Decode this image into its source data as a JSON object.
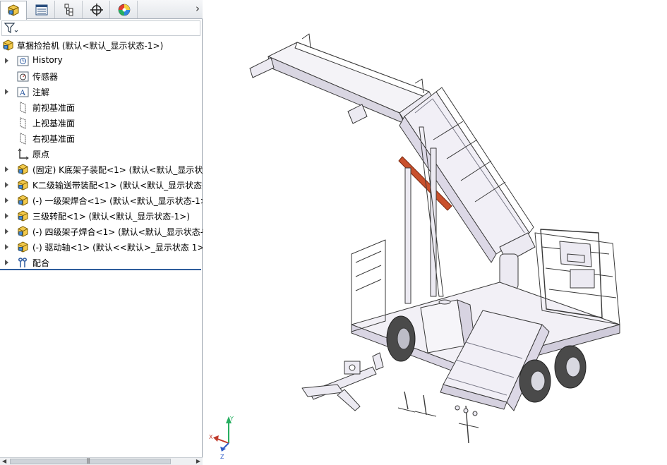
{
  "tabs": [
    {
      "name": "feature-manager",
      "icon": "assembly-icon",
      "active": true
    },
    {
      "name": "property-manager",
      "icon": "property-list-icon",
      "active": false
    },
    {
      "name": "configuration-manager",
      "icon": "configuration-icon",
      "active": false
    },
    {
      "name": "dimxpert-manager",
      "icon": "crosshair-icon",
      "active": false
    },
    {
      "name": "display-manager",
      "icon": "color-wheel-icon",
      "active": false
    }
  ],
  "tree": {
    "root": {
      "label": "草捆捡拾机 (默认<默认_显示状态-1>)",
      "icon": "assembly-icon"
    },
    "items": [
      {
        "label": "History",
        "icon": "history-icon",
        "expandable": true
      },
      {
        "label": "传感器",
        "icon": "sensor-icon",
        "expandable": false
      },
      {
        "label": "注解",
        "icon": "annotation-icon",
        "expandable": true
      },
      {
        "label": "前视基准面",
        "icon": "plane-icon",
        "expandable": false
      },
      {
        "label": "上视基准面",
        "icon": "plane-icon",
        "expandable": false
      },
      {
        "label": "右视基准面",
        "icon": "plane-icon",
        "expandable": false
      },
      {
        "label": "原点",
        "icon": "origin-icon",
        "expandable": false
      },
      {
        "label": "(固定) K底架子装配<1> (默认<默认_显示状态",
        "icon": "subassembly-icon",
        "expandable": true
      },
      {
        "label": "K二级输送带装配<1> (默认<默认_显示状态-",
        "icon": "subassembly-icon",
        "expandable": true
      },
      {
        "label": "(-) 一级架焊合<1> (默认<默认_显示状态-1>",
        "icon": "subassembly-icon",
        "expandable": true
      },
      {
        "label": "三级转配<1> (默认<默认_显示状态-1>)",
        "icon": "subassembly-icon",
        "expandable": true
      },
      {
        "label": "(-) 四级架子焊合<1> (默认<默认_显示状态-",
        "icon": "subassembly-icon",
        "expandable": true
      },
      {
        "label": "(-) 驱动轴<1> (默认<<默认>_显示状态 1>)",
        "icon": "subassembly-icon",
        "expandable": true
      },
      {
        "label": "配合",
        "icon": "mates-icon",
        "expandable": true
      }
    ]
  },
  "triad": {
    "x": "X",
    "y": "Y",
    "z": "Z"
  },
  "colors": {
    "accent": "#2f5d9c",
    "model_line": "#3a3a3a",
    "model_fill": "#eceaf2",
    "highlight_part": "#c9502c"
  }
}
